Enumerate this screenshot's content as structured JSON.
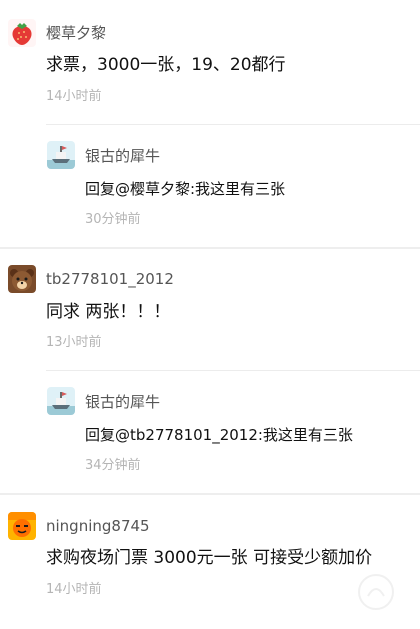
{
  "comments": [
    {
      "avatar": "strawberry-avatar-icon",
      "username": "樱草夕黎",
      "content": "求票，3000一张，19、20都行",
      "time": "14小时前",
      "reply": {
        "avatar": "ship-avatar-icon",
        "username": "银古的犀牛",
        "content": "回复@樱草夕黎:我这里有三张",
        "time": "30分钟前"
      }
    },
    {
      "avatar": "bear-avatar-icon",
      "username": "tb2778101_2012",
      "content": "同求 两张！！！",
      "time": "13小时前",
      "reply": {
        "avatar": "ship-avatar-icon",
        "username": "银古的犀牛",
        "content": "回复@tb2778101_2012:我这里有三张",
        "time": "34分钟前"
      }
    },
    {
      "avatar": "orange-face-avatar-icon",
      "username": "ningning8745",
      "content": "求购夜场门票 3000元一张 可接受少额加价",
      "time": "14小时前"
    }
  ]
}
